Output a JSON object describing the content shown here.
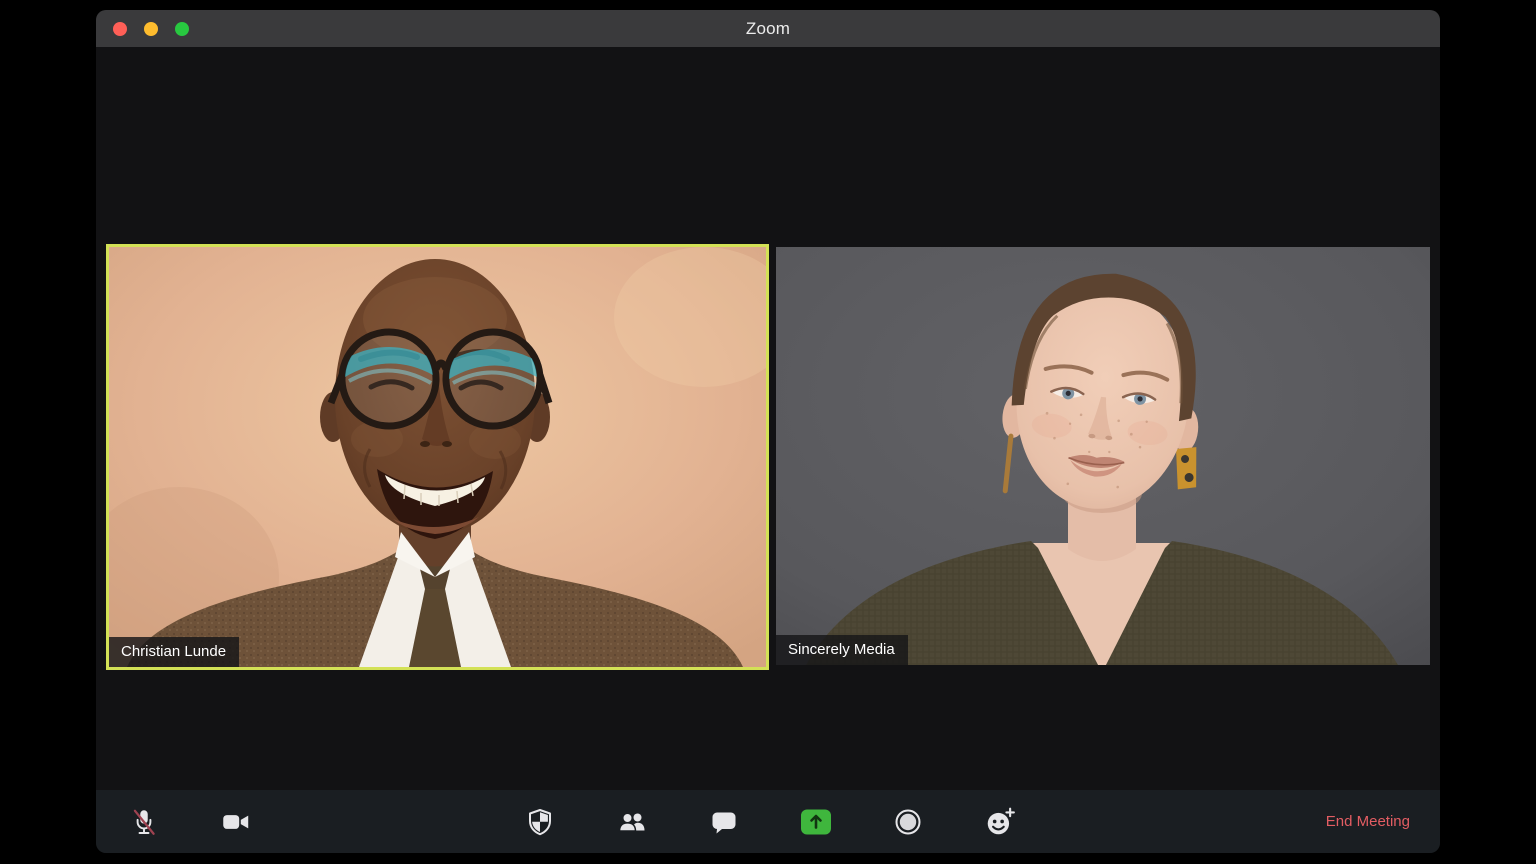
{
  "titlebar": {
    "title": "Zoom",
    "traffic_lights": [
      {
        "name": "close",
        "color": "#ff5f57"
      },
      {
        "name": "minimize",
        "color": "#febc2e"
      },
      {
        "name": "fullscreen",
        "color": "#28c840"
      }
    ]
  },
  "video_grid": {
    "tiles": [
      {
        "name": "Christian Lunde",
        "active_speaker": true,
        "highlight_color": "#d3e156"
      },
      {
        "name": "Sincerely Media",
        "active_speaker": false
      }
    ]
  },
  "toolbar": {
    "buttons": [
      {
        "id": "mute",
        "icon": "microphone-muted-icon",
        "state": "muted",
        "slash_color": "#9e4250"
      },
      {
        "id": "video",
        "icon": "video-camera-icon"
      },
      {
        "id": "security",
        "icon": "shield-icon"
      },
      {
        "id": "participants",
        "icon": "participants-icon"
      },
      {
        "id": "chat",
        "icon": "chat-bubble-icon"
      },
      {
        "id": "share-screen",
        "icon": "share-screen-arrow-icon",
        "accent_color": "#3fb63d"
      },
      {
        "id": "record",
        "icon": "record-circle-icon"
      },
      {
        "id": "reactions",
        "icon": "reactions-smiley-plus-icon"
      }
    ],
    "end_meeting_label": "End Meeting",
    "end_meeting_color": "#e35d63"
  }
}
